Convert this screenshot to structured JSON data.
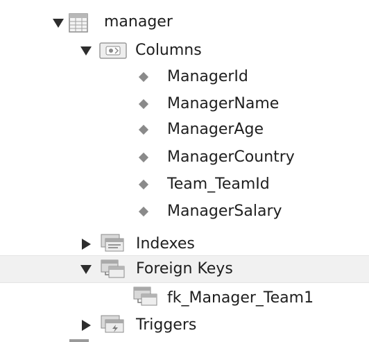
{
  "tree": {
    "table": {
      "label": "manager",
      "expanded": true,
      "icon": "table-icon"
    },
    "columns_folder": {
      "label": "Columns",
      "expanded": true,
      "icon": "columns-folder-icon"
    },
    "columns": [
      {
        "label": "ManagerId"
      },
      {
        "label": "ManagerName"
      },
      {
        "label": "ManagerAge"
      },
      {
        "label": "ManagerCountry"
      },
      {
        "label": "Team_TeamId"
      },
      {
        "label": "ManagerSalary"
      }
    ],
    "indexes_folder": {
      "label": "Indexes",
      "expanded": false,
      "icon": "indexes-folder-icon"
    },
    "foreign_keys_folder": {
      "label": "Foreign Keys",
      "expanded": true,
      "selected": true,
      "icon": "foreign-keys-folder-icon"
    },
    "foreign_keys": [
      {
        "label": "fk_Manager_Team1",
        "icon": "foreign-key-icon"
      }
    ],
    "triggers_folder": {
      "label": "Triggers",
      "expanded": false,
      "icon": "triggers-folder-icon"
    }
  }
}
